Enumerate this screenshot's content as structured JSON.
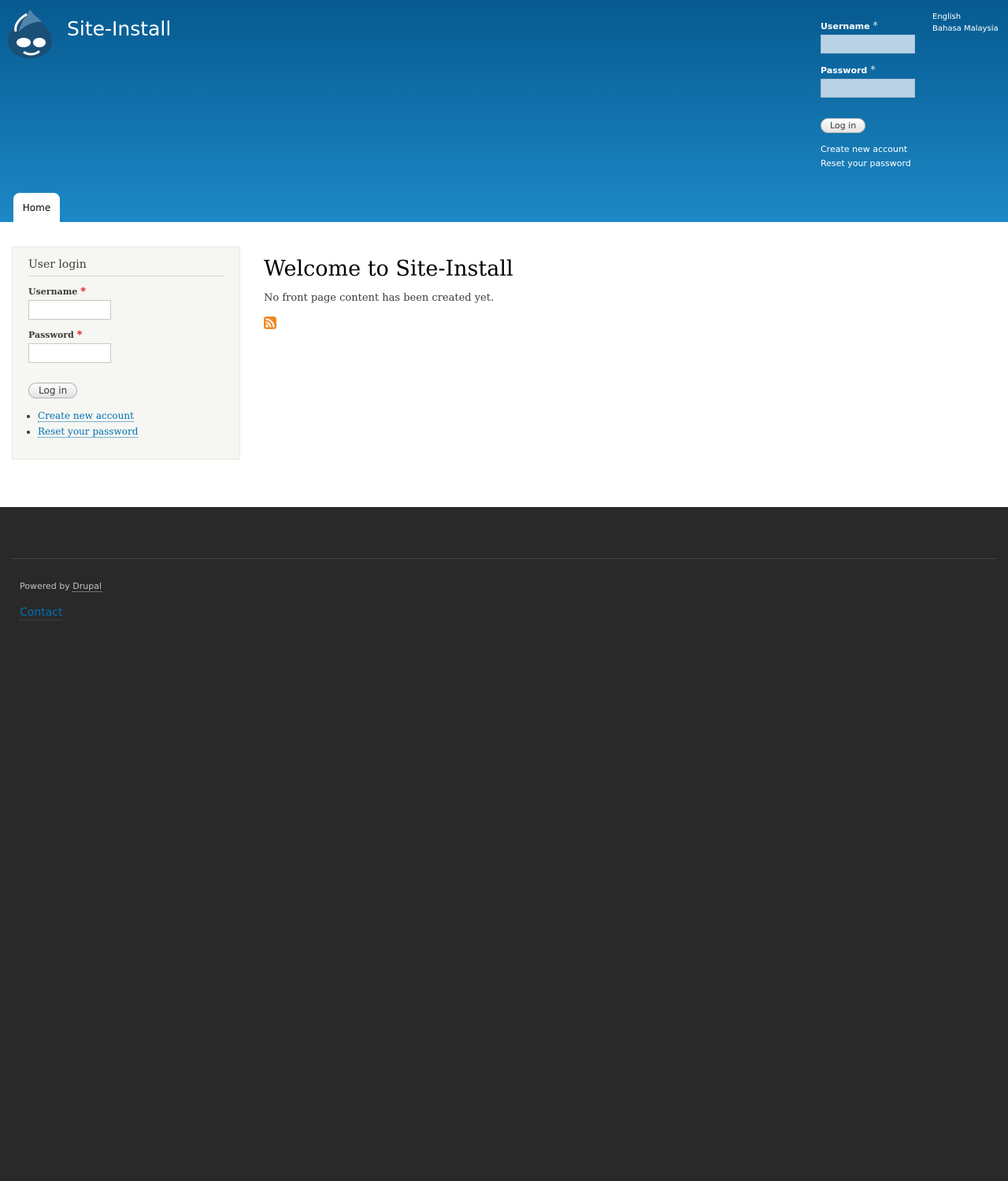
{
  "header": {
    "logo_icon": "drupal-drop-icon",
    "site_name": "Site-Install",
    "login": {
      "username_label": "Username",
      "password_label": "Password",
      "required_marker": "*",
      "login_button": "Log in",
      "create_account": "Create new account",
      "reset_password": "Reset your password"
    },
    "languages": [
      "English",
      "Bahasa Malaysia"
    ]
  },
  "nav": {
    "tabs": [
      {
        "label": "Home"
      }
    ]
  },
  "sidebar": {
    "block_title": "User login",
    "username_label": "Username",
    "password_label": "Password",
    "required_marker": "*",
    "login_button": "Log in",
    "links": [
      "Create new account",
      "Reset your password"
    ]
  },
  "content": {
    "title": "Welcome to Site-Install",
    "message": "No front page content has been created yet.",
    "feed_icon": "rss-feed-icon"
  },
  "footer": {
    "powered_by": "Powered by",
    "powered_link": "Drupal",
    "contact": "Contact"
  },
  "colors": {
    "header_top": "#065a90",
    "header_bottom": "#1d88c6",
    "link": "#0071b3",
    "footer_bg": "#292929",
    "sidebar_bg": "#f6f6f2",
    "required": "#e01010",
    "rss": "#f08a24"
  }
}
